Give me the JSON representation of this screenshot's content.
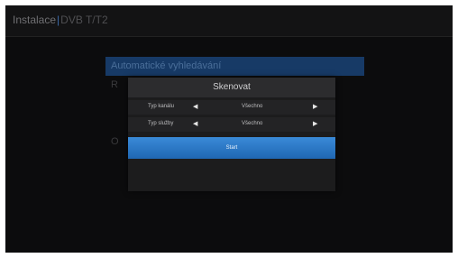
{
  "header": {
    "title": "Instalace",
    "separator": "|",
    "subtitle": "DVB T/T2"
  },
  "background_menu": {
    "selected_item": "Automatické vyhledávání",
    "partial_item_1": "R",
    "partial_item_2": "O"
  },
  "dialog": {
    "title": "Skenovat",
    "rows": [
      {
        "label": "Typ kanálu",
        "value": "Všechno",
        "left_arrow": "◀",
        "right_arrow": "▶"
      },
      {
        "label": "Typ služby",
        "value": "Všechno",
        "left_arrow": "◀",
        "right_arrow": "▶"
      }
    ],
    "start_label": "Start"
  },
  "colors": {
    "accent_blue": "#2a78c8",
    "selected_menu_blue": "#173a66",
    "screen_bg": "#0c0c0d"
  }
}
